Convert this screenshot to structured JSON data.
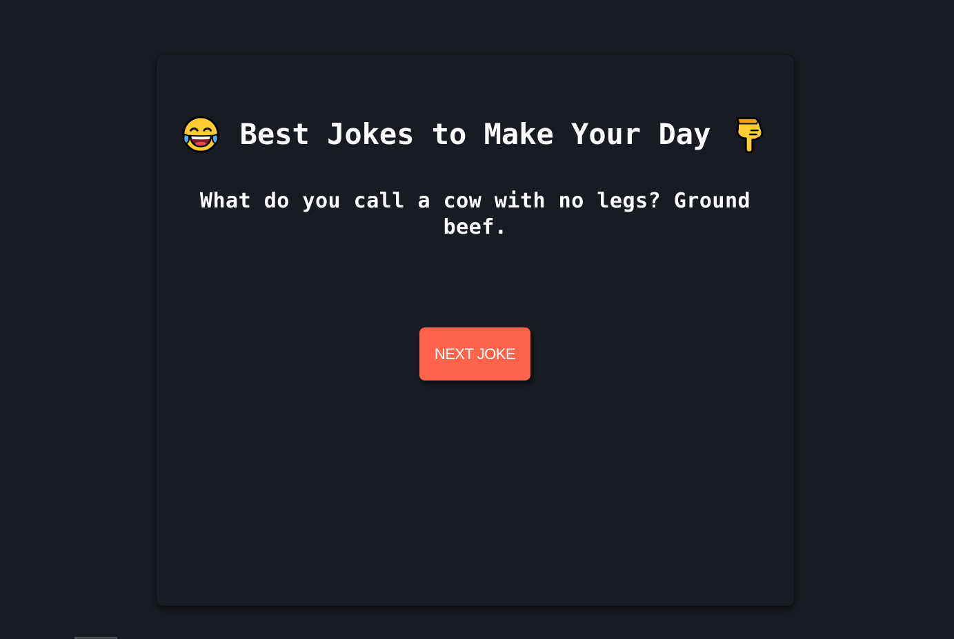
{
  "header": {
    "title": "Best Jokes to Make Your Day",
    "left_icon": "face-with-tears-of-joy-icon",
    "right_icon": "pointing-down-hand-icon"
  },
  "joke": {
    "text": "What do you call a cow with no legs? Ground beef."
  },
  "controls": {
    "next_label": "NEXT JOKE"
  },
  "colors": {
    "background": "#181b21",
    "card": "#181b21",
    "accent": "#ff634a",
    "text": "#ffffff"
  }
}
